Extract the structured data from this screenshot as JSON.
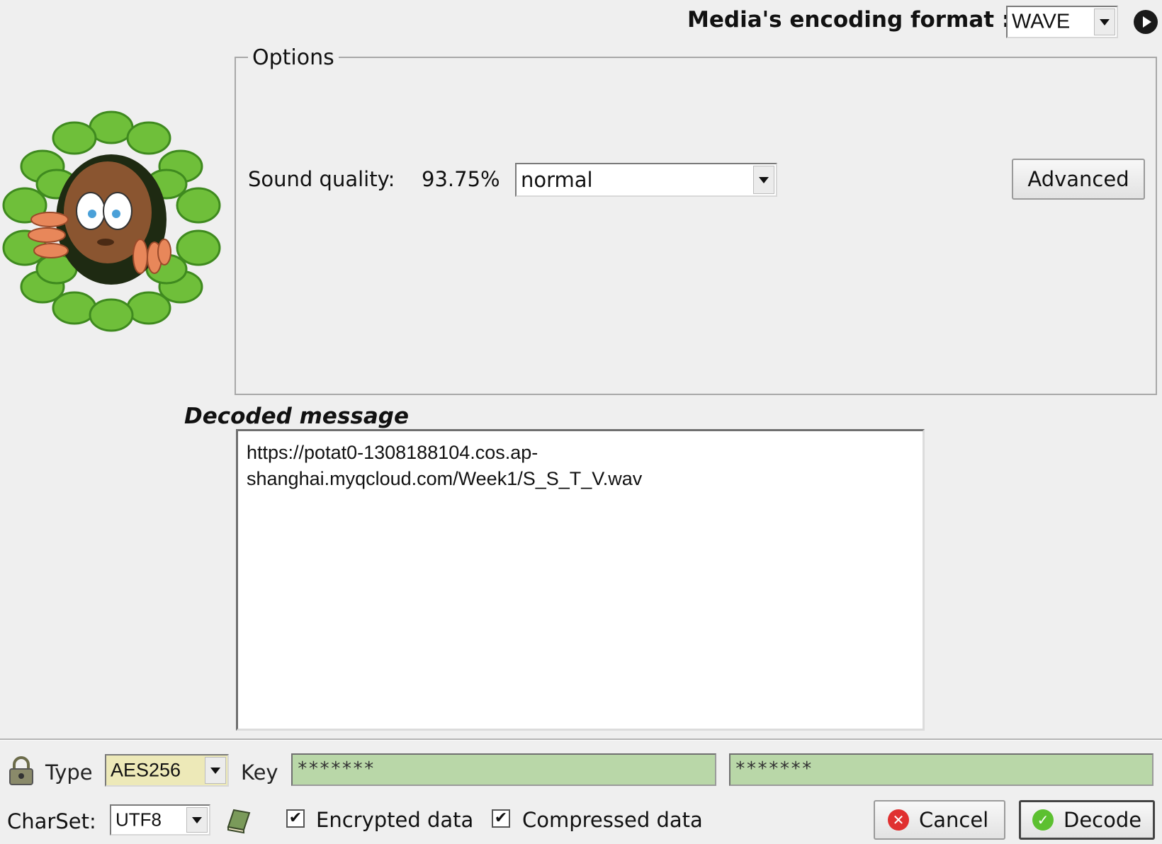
{
  "header": {
    "format_label": "Media's encoding format :",
    "format_value": "WAVE"
  },
  "options": {
    "legend": "Options",
    "sound_quality_label": "Sound quality:",
    "sound_quality_value": "93.75%",
    "quality_select": "normal",
    "advanced_button": "Advanced"
  },
  "decoded": {
    "title": "Decoded message",
    "line1": "https://potat0-1308188104.cos.ap-",
    "line2": "shanghai.myqcloud.com/Week1/S_S_T_V.wav"
  },
  "crypto": {
    "type_label": "Type",
    "type_value": "AES256",
    "key_label": "Key",
    "key_value": "*******",
    "key_confirm_value": "*******"
  },
  "footer": {
    "charset_label": "CharSet:",
    "charset_value": "UTF8",
    "encrypted_label": "Encrypted data",
    "encrypted_checked": true,
    "compressed_label": "Compressed data",
    "compressed_checked": true,
    "cancel_button": "Cancel",
    "decode_button": "Decode"
  },
  "colors": {
    "key_field_bg": "#b9d7a8",
    "type_field_bg": "#ede9b8",
    "leaf_green": "#6fbf3a"
  }
}
